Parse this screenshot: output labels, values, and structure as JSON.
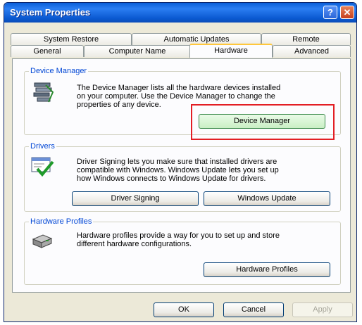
{
  "window": {
    "title": "System Properties",
    "help_label": "?",
    "close_label": "✕"
  },
  "tabs_top": [
    "System Restore",
    "Automatic Updates",
    "Remote"
  ],
  "tabs_bottom": [
    "General",
    "Computer Name",
    "Hardware",
    "Advanced"
  ],
  "active_tab": "Hardware",
  "device_manager": {
    "legend": "Device Manager",
    "desc_lines": [
      "The Device Manager lists all the hardware devices installed",
      "on your computer. Use the Device Manager to change the",
      "properties of any device."
    ],
    "button": "Device Manager"
  },
  "drivers": {
    "legend": "Drivers",
    "desc_lines": [
      "Driver Signing lets you make sure that installed drivers are",
      "compatible with Windows. Windows Update lets you set up",
      "how Windows connects to Windows Update for drivers."
    ],
    "signing_button": "Driver Signing",
    "update_button": "Windows Update"
  },
  "hardware_profiles": {
    "legend": "Hardware Profiles",
    "desc_lines": [
      "Hardware profiles provide a way for you to set up and store",
      "different hardware configurations."
    ],
    "button": "Hardware Profiles"
  },
  "footer": {
    "ok": "OK",
    "cancel": "Cancel",
    "apply": "Apply"
  },
  "icons": {
    "device_manager": "device-manager-icon",
    "drivers": "driver-signing-icon",
    "hardware_profiles": "hardware-profile-icon"
  },
  "colors": {
    "title_bar": "#0a58d0",
    "highlight": "#e31e24",
    "group_label": "#0046d5"
  }
}
